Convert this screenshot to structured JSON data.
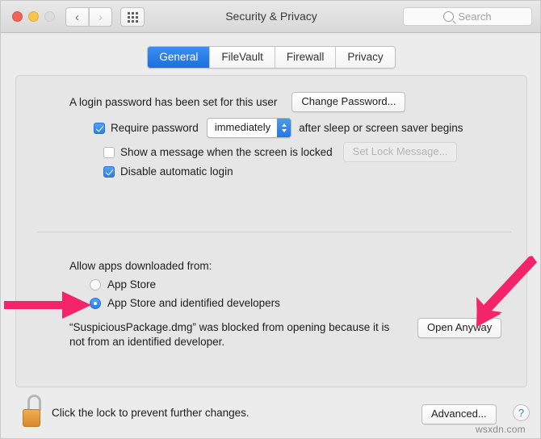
{
  "window": {
    "title": "Security & Privacy",
    "traffic_lights": [
      "close",
      "minimize",
      "zoom"
    ],
    "nav": {
      "back": "‹",
      "forward": "›",
      "grid": "show-all-grid"
    },
    "search": {
      "placeholder": "Search",
      "value": ""
    }
  },
  "tabs": [
    {
      "label": "General",
      "active": true
    },
    {
      "label": "FileVault",
      "active": false
    },
    {
      "label": "Firewall",
      "active": false
    },
    {
      "label": "Privacy",
      "active": false
    }
  ],
  "general": {
    "login_password_text": "A login password has been set for this user",
    "change_password_label": "Change Password...",
    "require_password": {
      "checked": true,
      "label_before": "Require password",
      "popup_value": "immediately",
      "label_after": "after sleep or screen saver begins"
    },
    "show_message": {
      "checked": false,
      "label": "Show a message when the screen is locked",
      "button_label": "Set Lock Message...",
      "button_disabled": true
    },
    "disable_auto_login": {
      "checked": true,
      "label": "Disable automatic login"
    },
    "allow_apps_label": "Allow apps downloaded from:",
    "radios": [
      {
        "label": "App Store",
        "selected": false
      },
      {
        "label": "App Store and identified developers",
        "selected": true
      }
    ],
    "blocked_message": "“SuspiciousPackage.dmg” was blocked from opening because it is not from an identified developer.",
    "open_anyway_label": "Open Anyway"
  },
  "footer": {
    "lock_icon": "unlocked-padlock-icon",
    "lock_text": "Click the lock to prevent further changes.",
    "advanced_label": "Advanced...",
    "help_label": "?"
  },
  "annotations": {
    "arrow_color": "#F4246A",
    "left_arrow": "arrow-pointing-right-at-identified-developers-radio",
    "right_arrow": "arrow-pointing-down-left-at-open-anyway-button"
  },
  "watermark": "wsxdn.com"
}
